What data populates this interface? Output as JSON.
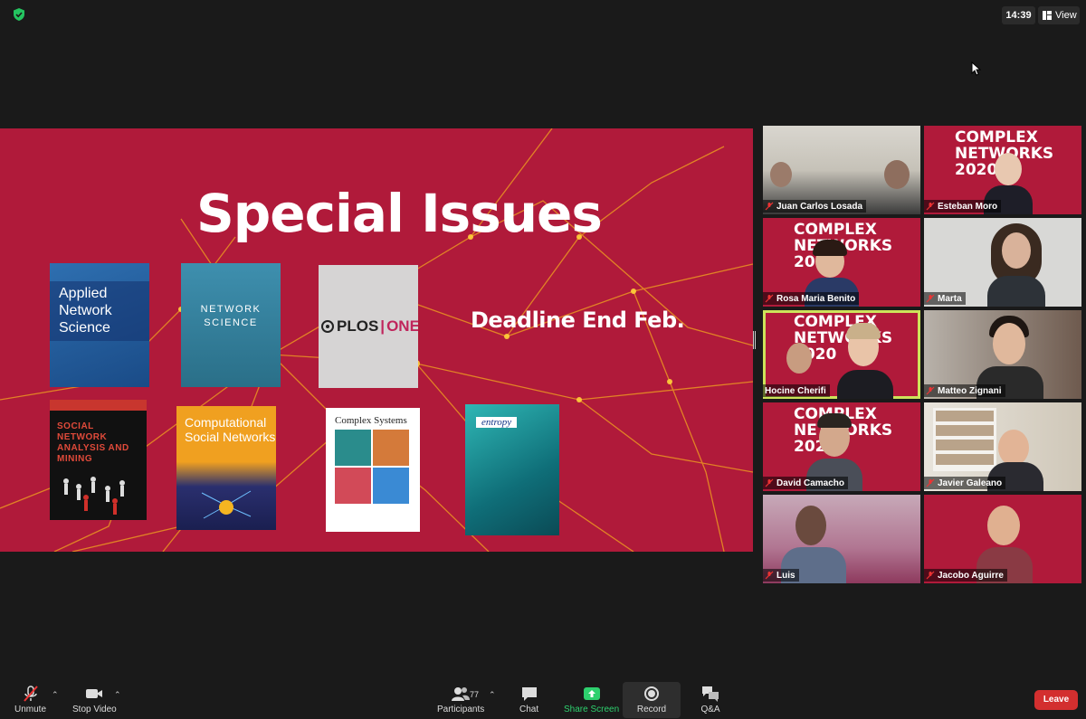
{
  "header": {
    "clock": "14:39",
    "view_label": "View",
    "shield_icon": "shield-check-icon",
    "security_color": "#24c460"
  },
  "slide": {
    "title": "Special Issues",
    "deadline": "Deadline End Feb.",
    "background_color": "#b01a3a",
    "covers": {
      "applied_network_science": "Applied Network Science",
      "network_science": "NETWORK SCIENCE",
      "plos": "PLOS",
      "plos_one": "ONE",
      "sna": "SOCIAL NETWORK ANALYSIS AND MINING",
      "csn": "Computational Social Networks",
      "complex_systems": "Complex Systems",
      "entropy": "entropy"
    }
  },
  "banner": {
    "line1": "COMPLEX",
    "line2": "NETWORKS",
    "line3": "2020"
  },
  "participants_tiles": [
    {
      "name": "Juan Carlos Losada"
    },
    {
      "name": "Esteban Moro"
    },
    {
      "name": "Rosa Maria Benito"
    },
    {
      "name": "Marta"
    },
    {
      "name": "Hocine Cherifi"
    },
    {
      "name": "Matteo Zignani"
    },
    {
      "name": "David Camacho"
    },
    {
      "name": "Javier Galeano"
    },
    {
      "name": "Luis"
    },
    {
      "name": "Jacobo Aguirre"
    }
  ],
  "toolbar": {
    "unmute": "Unmute",
    "stop_video": "Stop Video",
    "participants": "Participants",
    "participants_count": "77",
    "chat": "Chat",
    "share_screen": "Share Screen",
    "record": "Record",
    "qa": "Q&A",
    "leave": "Leave",
    "share_color": "#2ed06e",
    "leave_color": "#d32f2f"
  }
}
